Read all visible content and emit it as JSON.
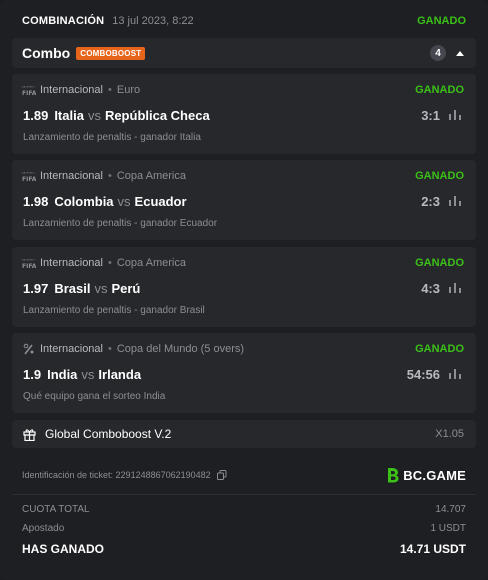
{
  "header": {
    "kind": "COMBINACIÓN",
    "date": "13 jul 2023, 8:22",
    "status": "GANADO"
  },
  "combo": {
    "title": "Combo",
    "tag": "COMBOBOOST",
    "count": "4"
  },
  "bets": [
    {
      "category": "Internacional",
      "competition": "Euro",
      "result": "GANADO",
      "odds": "1.89",
      "home": "Italia",
      "vs": "vs",
      "away": "República Checa",
      "score": "3:1",
      "market": "Lanzamiento de penaltis - ganador Italia",
      "icon": "fifa-icon"
    },
    {
      "category": "Internacional",
      "competition": "Copa America",
      "result": "GANADO",
      "odds": "1.98",
      "home": "Colombia",
      "vs": "vs",
      "away": "Ecuador",
      "score": "2:3",
      "market": "Lanzamiento de penaltis - ganador Ecuador",
      "icon": "fifa-icon"
    },
    {
      "category": "Internacional",
      "competition": "Copa America",
      "result": "GANADO",
      "odds": "1.97",
      "home": "Brasil",
      "vs": "vs",
      "away": "Perú",
      "score": "4:3",
      "market": "Lanzamiento de penaltis - ganador Brasil",
      "icon": "fifa-icon"
    },
    {
      "category": "Internacional",
      "competition": "Copa del Mundo (5 overs)",
      "result": "GANADO",
      "odds": "1.9",
      "home": "India",
      "vs": "vs",
      "away": "Irlanda",
      "score": "54:56",
      "market": "Qué equipo gana el sorteo India",
      "icon": "cricket-icon"
    }
  ],
  "boost": {
    "label": "Global Comboboost V.2",
    "multiplier": "X1.05"
  },
  "ticket": {
    "label": "Identificación de ticket: 2291248867062190482",
    "brand": "BC.GAME"
  },
  "summary": {
    "total_odds_label": "CUOTA TOTAL",
    "total_odds": "14.707",
    "staked_label": "Apostado",
    "staked": "1 USDT",
    "won_label": "HAS GANADO",
    "won": "14.71 USDT"
  },
  "colors": {
    "win_green": "#3bc117",
    "boost_tag": "#e7641b",
    "brand_green": "#3bc117"
  }
}
